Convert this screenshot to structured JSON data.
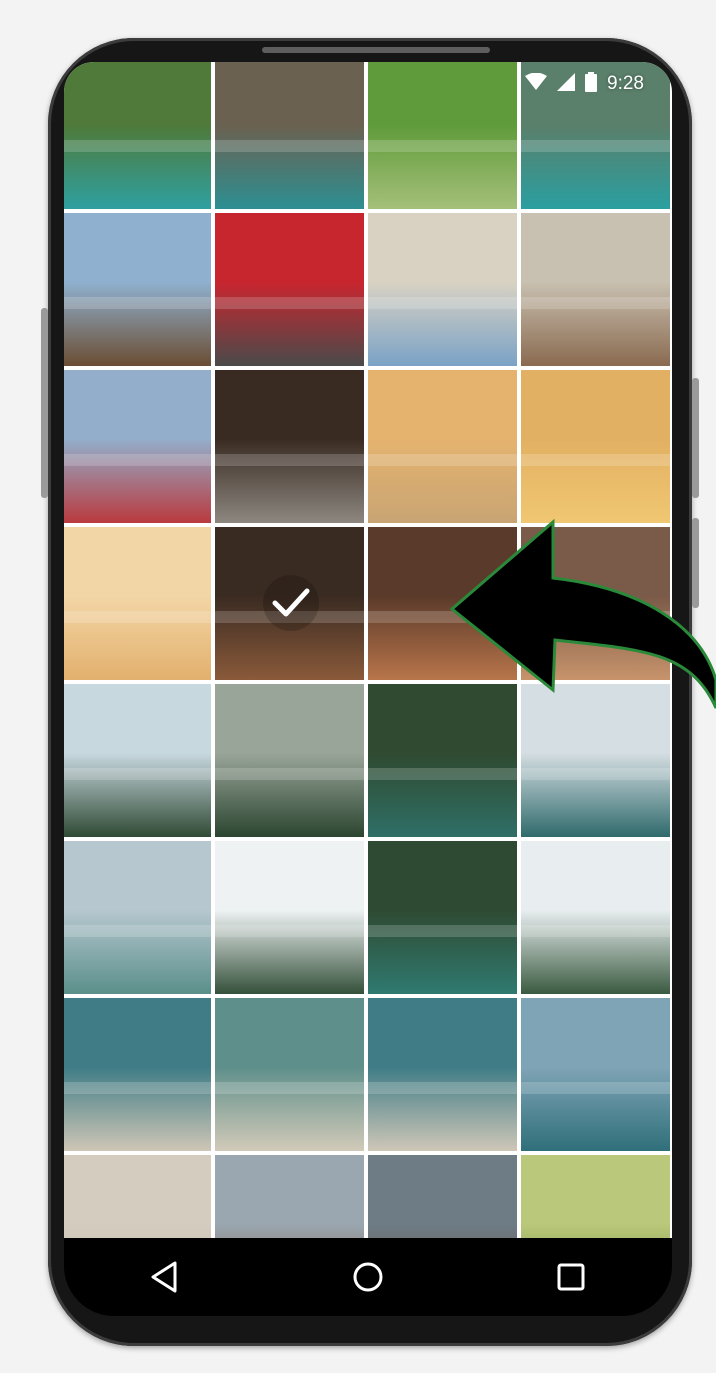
{
  "status_bar": {
    "time": "9:28",
    "icons": [
      "wifi-icon",
      "signal-icon",
      "battery-icon"
    ]
  },
  "photo_grid": {
    "columns": 4,
    "tiles": [
      {
        "name": "tropical-cliff-boat",
        "c1": "#4f7a3a",
        "c2": "#2fa0a0"
      },
      {
        "name": "limestone-cliff-boat",
        "c1": "#6b6150",
        "c2": "#2d8f92"
      },
      {
        "name": "palm-leaves",
        "c1": "#5f9b3a",
        "c2": "#a5c07a"
      },
      {
        "name": "cliff-lagoon",
        "c1": "#5a7f6a",
        "c2": "#2a9fa0"
      },
      {
        "name": "tower-bridge-selfie",
        "c1": "#8fb1cf",
        "c2": "#6b4d33"
      },
      {
        "name": "red-bus-window",
        "c1": "#c8262f",
        "c2": "#4a4a4a"
      },
      {
        "name": "tower-bridge-tower",
        "c1": "#d9d2c3",
        "c2": "#7aa2c6"
      },
      {
        "name": "tower-bridge-arch",
        "c1": "#c8c0b0",
        "c2": "#8a6a50"
      },
      {
        "name": "bridge-bus-selfie",
        "c1": "#93aecb",
        "c2": "#b93a3e"
      },
      {
        "name": "man-scarf-smile",
        "c1": "#3a2b22",
        "c2": "#8c8780"
      },
      {
        "name": "beach-waves-sunset",
        "c1": "#e5b36e",
        "c2": "#c8a474"
      },
      {
        "name": "beach-walk-reflection",
        "c1": "#e2b062",
        "c2": "#f0c772"
      },
      {
        "name": "couple-beach-sunset",
        "c1": "#f3d6a6",
        "c2": "#e2b06d"
      },
      {
        "name": "birthday-cake-group",
        "c1": "#3a2b22",
        "c2": "#8a5a3a"
      },
      {
        "name": "birthday-blow-candles",
        "c1": "#5a3a2a",
        "c2": "#b8754a"
      },
      {
        "name": "birthday-friends",
        "c1": "#7a5a48",
        "c2": "#c7936b"
      },
      {
        "name": "forest-mountain-mist",
        "c1": "#c8d8df",
        "c2": "#2f4a35"
      },
      {
        "name": "mountain-forest",
        "c1": "#9aa59a",
        "c2": "#2b4530"
      },
      {
        "name": "lake-boat-forest",
        "c1": "#2f4a30",
        "c2": "#2f6f66"
      },
      {
        "name": "lake-forest-shore",
        "c1": "#d5dee2",
        "c2": "#2f6a6c"
      },
      {
        "name": "hiker-smiling-lake",
        "c1": "#b6c7cf",
        "c2": "#5a8f8a"
      },
      {
        "name": "forest-treeline",
        "c1": "#eef2f3",
        "c2": "#34503a"
      },
      {
        "name": "green-lake",
        "c1": "#2f4a32",
        "c2": "#2f7a70"
      },
      {
        "name": "pine-forest-shore",
        "c1": "#e8eef0",
        "c2": "#3a5a40"
      },
      {
        "name": "volleyball-beach",
        "c1": "#3f7c86",
        "c2": "#cfc6b6"
      },
      {
        "name": "volleyball-sand",
        "c1": "#5e8f8a",
        "c2": "#d2cab9"
      },
      {
        "name": "volleyball-closeup",
        "c1": "#3f7c86",
        "c2": "#cfc7b8"
      },
      {
        "name": "sea-horizon",
        "c1": "#7fa4b6",
        "c2": "#2f6f7a"
      },
      {
        "name": "volleyball-sand-2",
        "c1": "#d4cdbf",
        "c2": "#bdb4a5"
      },
      {
        "name": "couple-selfie-1",
        "c1": "#9aa7b0",
        "c2": "#7a5842"
      },
      {
        "name": "couple-selfie-2",
        "c1": "#6e7c86",
        "c2": "#6a4a38"
      },
      {
        "name": "palm-fronds",
        "c1": "#b9c87a",
        "c2": "#6e8a3a"
      }
    ],
    "selected_index": 13
  },
  "nav_bar": {
    "buttons": [
      "back-button",
      "home-button",
      "recents-button"
    ]
  },
  "annotation": {
    "arrow_color": "#000000",
    "arrow_outline": "#2a8a3a"
  }
}
